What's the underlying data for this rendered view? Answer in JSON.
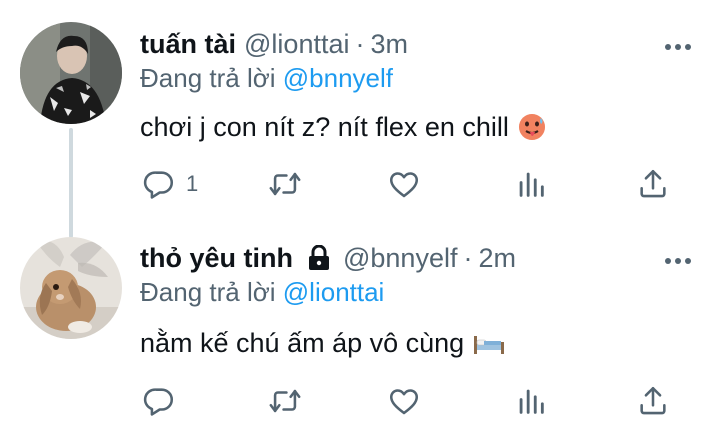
{
  "tweets": [
    {
      "name": "tuấn tài",
      "handle": "@lionttai",
      "separator": "·",
      "time": "3m",
      "reply_prefix": "Đang trả lời ",
      "reply_to": "@bnnyelf",
      "text": "chơi j con nít z? nít flex en chill",
      "emoji": "hot-face-emoji",
      "stats": {
        "replies": "1",
        "retweets": "",
        "likes": ""
      }
    },
    {
      "name": "thỏ yêu tinh",
      "handle": "@bnnyelf",
      "separator": "·",
      "time": "2m",
      "locked": true,
      "reply_prefix": "Đang trả lời ",
      "reply_to": "@lionttai",
      "text": "nằm kế chú ấm áp vô cùng",
      "emoji": "bed-emoji",
      "stats": {
        "replies": "",
        "retweets": "",
        "likes": ""
      }
    }
  ],
  "colors": {
    "text": "#0f1419",
    "secondary": "#536471",
    "link": "#1d9bf0",
    "thread_line": "#cfd9de"
  },
  "icons": [
    "reply-icon",
    "retweet-icon",
    "like-icon",
    "analytics-icon",
    "share-icon",
    "more-icon",
    "lock-icon"
  ]
}
